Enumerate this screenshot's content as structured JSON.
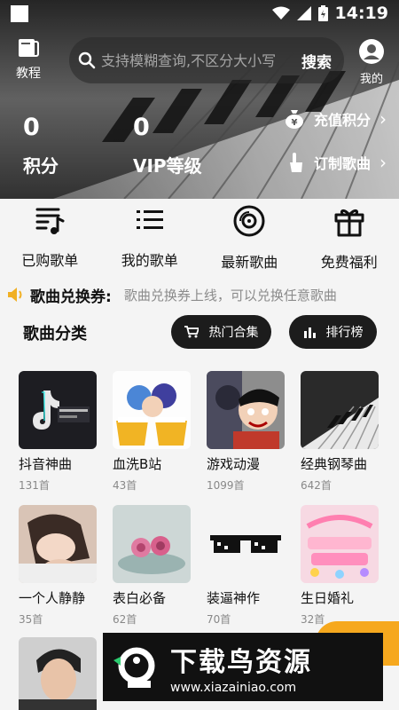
{
  "status_bar": {
    "time": "14:19"
  },
  "header": {
    "tutorial_label": "教程",
    "search_placeholder": "支持模糊查询,不区分大小写",
    "search_button": "搜索",
    "mine_label": "我的",
    "points_value": "0",
    "points_label": "积分",
    "vip_value": "0",
    "vip_label": "VIP等级",
    "recharge_label": "充值积分",
    "custom_song_label": "订制歌曲"
  },
  "quick_nav": [
    {
      "label": "已购歌单",
      "icon": "purchased-playlist-icon"
    },
    {
      "label": "我的歌单",
      "icon": "list-icon"
    },
    {
      "label": "最新歌曲",
      "icon": "disc-icon"
    },
    {
      "label": "免费福利",
      "icon": "gift-icon"
    }
  ],
  "notice": {
    "title": "歌曲兑换券:",
    "text": "歌曲兑换券上线，可以兑换任意歌曲"
  },
  "categories": {
    "title": "歌曲分类",
    "hot_button": "热门合集",
    "rank_button": "排行榜",
    "items": [
      {
        "name": "抖音神曲",
        "count": "131首"
      },
      {
        "name": "血洗B站",
        "count": "43首"
      },
      {
        "name": "游戏动漫",
        "count": "1099首"
      },
      {
        "name": "经典钢琴曲",
        "count": "642首"
      },
      {
        "name": "一个人静静",
        "count": "35首"
      },
      {
        "name": "表白必备",
        "count": "62首"
      },
      {
        "name": "装逼神作",
        "count": "70首"
      },
      {
        "name": "生日婚礼",
        "count": "32首"
      }
    ]
  },
  "watermark": {
    "title": "下载鸟资源",
    "url": "www.xiazainiao.com"
  },
  "colors": {
    "dark": "#1c1c1c",
    "accent_orange": "#f6a81e",
    "muted": "#888888"
  }
}
